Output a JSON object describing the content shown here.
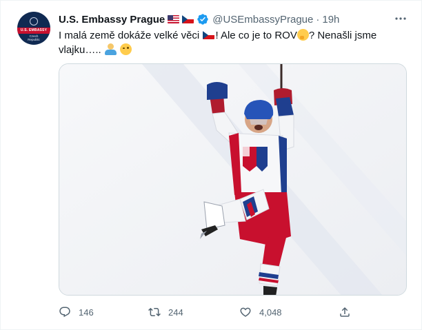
{
  "account": {
    "name": "U.S. Embassy Prague",
    "handle": "@USEmbassyPrague",
    "separator": "·",
    "time": "19h",
    "avatar_band_text": "U.S. EMBASSY",
    "avatar_sub_text": "Czech\nRepublic"
  },
  "tweet": {
    "text_1": "I malá země dokáže velké věci ",
    "text_2": "! Ale co je to ROV",
    "text_3": "? Nenašli jsme vlajku….. ",
    "emojis": [
      "flag-czech-republic",
      "thinking-face",
      "person-shrugging",
      "winking-face"
    ]
  },
  "media": {
    "type": "photo",
    "subject": "hockey-player-celebrating"
  },
  "actions": {
    "replies": "146",
    "retweets": "244",
    "likes": "4,048"
  },
  "icons": [
    "verified-badge-icon",
    "more-icon",
    "reply-icon",
    "retweet-icon",
    "like-icon",
    "share-icon"
  ],
  "colors": {
    "text": "#0f1419",
    "muted": "#536471",
    "verified": "#1d9bf0",
    "border": "#cfd9de"
  }
}
